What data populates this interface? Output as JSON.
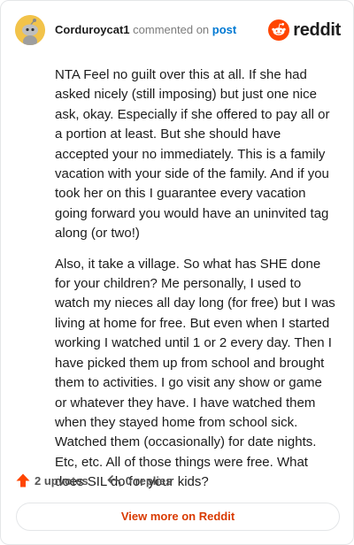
{
  "header": {
    "username": "Corduroycat1",
    "action_text": "commented on",
    "post_link": "post",
    "brand_name": "reddit"
  },
  "comment": {
    "paragraphs": [
      "NTA Feel no guilt over this at all. If she had asked nicely (still imposing) but just one nice ask, okay. Especially if she offered to pay all or a portion at least. But she should have accepted your no immediately. This is a family vacation with your side of the family. And if you took her on this I guarantee every vacation going forward you would have an uninvited tag along (or two!)",
      "Also, it take a village. So what has SHE done for your children? Me personally, I used to watch my nieces all day long (for free) but I was living at home for free. But even when I started working I watched until 1 or 2 every day. Then I have picked them up from school and brought them to activities. I go visit any show or game or whatever they have. I have watched them when they stayed home from school sick. Watched them (occasionally) for date nights. Etc, etc. All of those things were free. What does SIL do for your kids?"
    ]
  },
  "actions": {
    "upvotes": "2 upvotes",
    "replies": "0 replies"
  },
  "footer": {
    "view_more_label": "View more on Reddit"
  },
  "colors": {
    "accent": "#d93a00",
    "link": "#0079d3",
    "upvote": "#ff4500",
    "avatar_bg": "#f2c34a"
  },
  "icons": {
    "avatar": "snoo-avatar-icon",
    "brand": "reddit-logo-icon",
    "upvote": "upvote-arrow-icon",
    "reply": "reply-arrow-icon"
  }
}
